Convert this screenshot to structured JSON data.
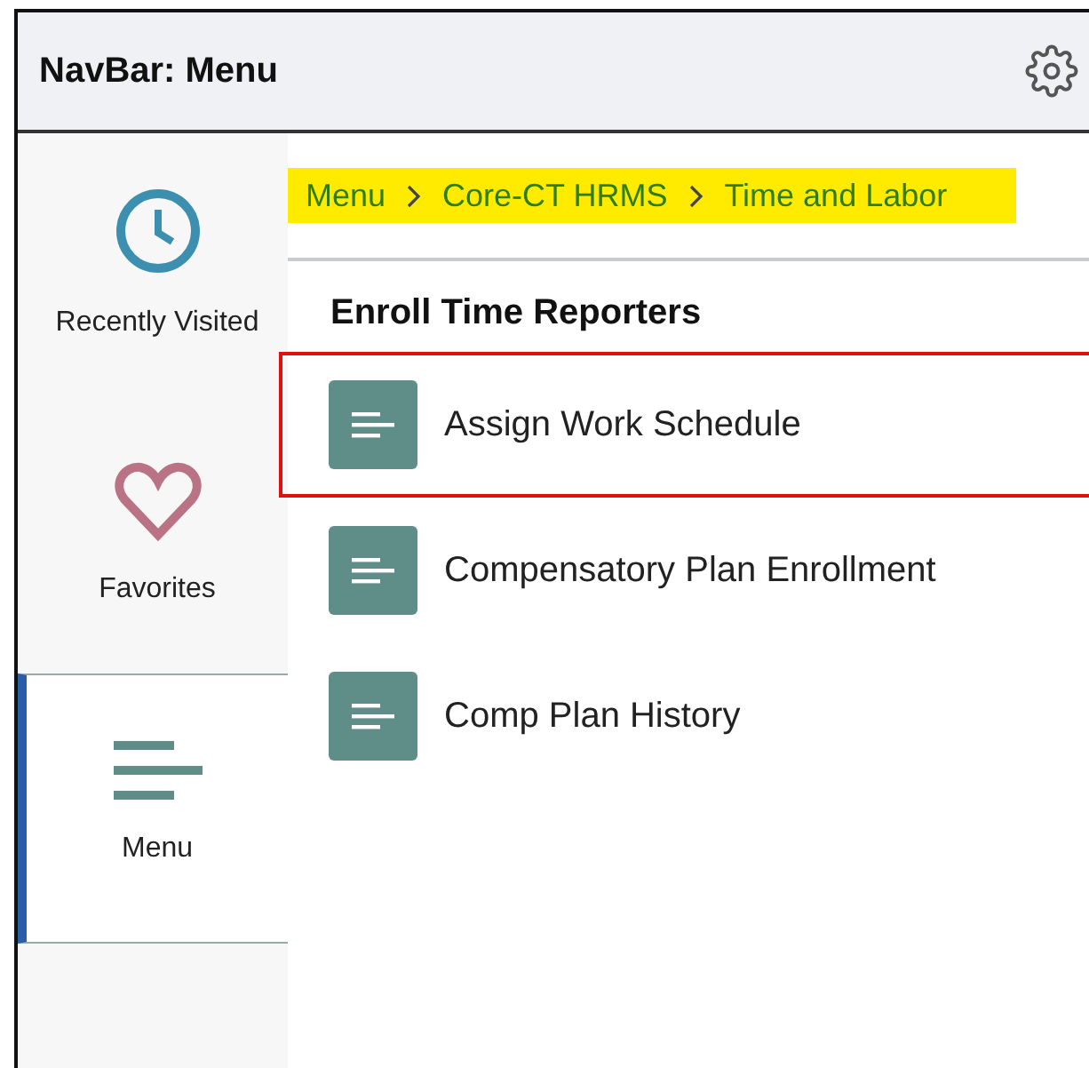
{
  "header": {
    "title": "NavBar: Menu"
  },
  "sidebar": {
    "items": [
      {
        "kind": "clock",
        "label": "Recently Visited",
        "selected": false
      },
      {
        "kind": "heart",
        "label": "Favorites",
        "selected": false
      },
      {
        "kind": "menu",
        "label": "Menu",
        "selected": true
      }
    ]
  },
  "breadcrumb": {
    "highlighted": true,
    "items": [
      "Menu",
      "Core-CT HRMS",
      "Time and Labor"
    ]
  },
  "section": {
    "title": "Enroll Time Reporters",
    "items": [
      {
        "label": "Assign Work Schedule",
        "highlighted": true
      },
      {
        "label": "Compensatory Plan Enrollment",
        "highlighted": false
      },
      {
        "label": "Comp Plan History",
        "highlighted": false
      }
    ]
  }
}
